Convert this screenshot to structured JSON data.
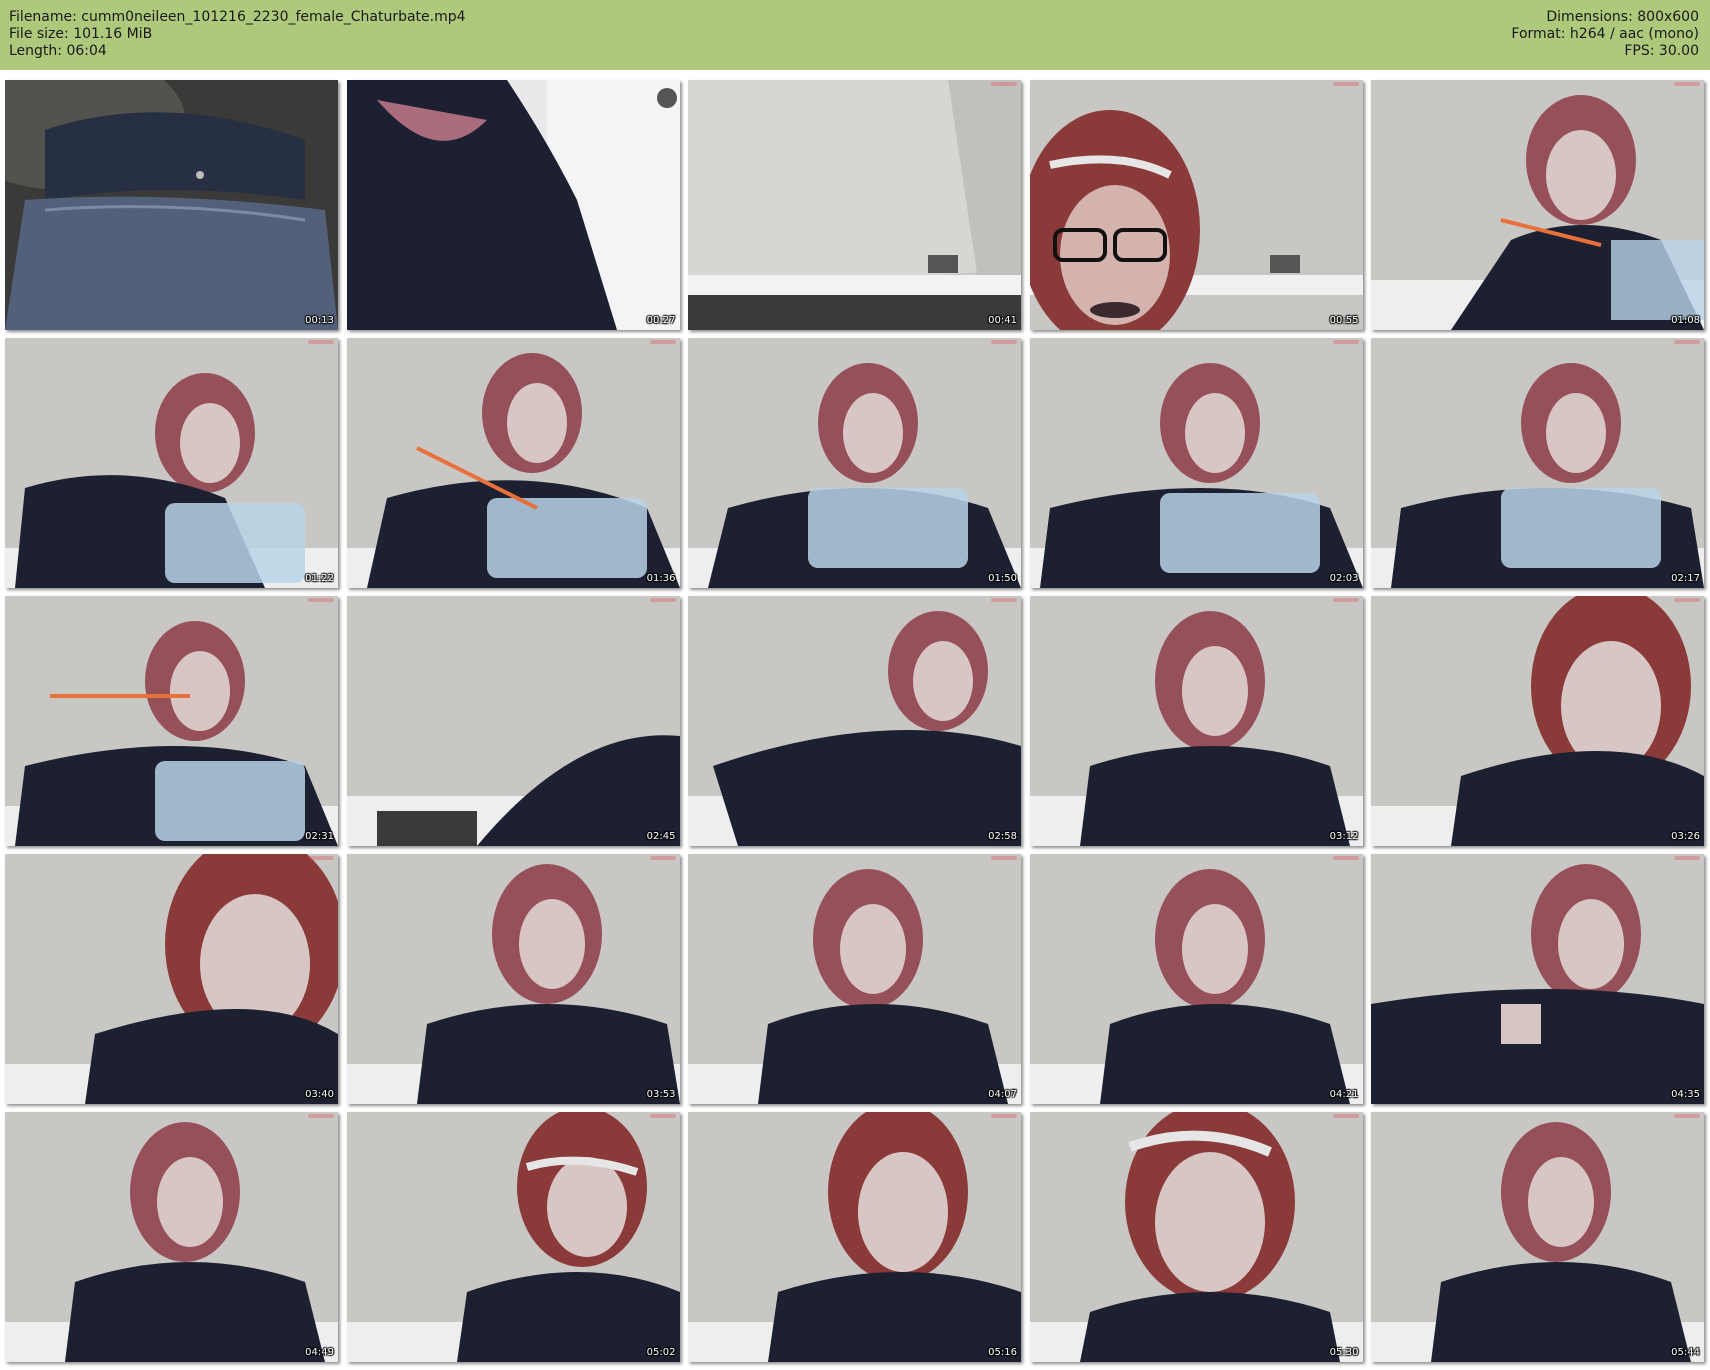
{
  "header": {
    "filename_line": "Filename: cumm0neileen_101216_2230_female_Chaturbate.mp4",
    "filesize_line": "File size: 101.16 MiB",
    "length_line": "Length: 06:04",
    "dimensions_line": "Dimensions: 800x600",
    "format_line": "Format: h264 / aac (mono)",
    "fps_line": "FPS: 30.00"
  },
  "colors": {
    "header_background": "#aec87c",
    "page_background": "#ffffff"
  },
  "thumbnails": [
    {
      "time": "00:13"
    },
    {
      "time": "00:27"
    },
    {
      "time": "00:41"
    },
    {
      "time": "00:55"
    },
    {
      "time": "01:08"
    },
    {
      "time": "01:22"
    },
    {
      "time": "01:36"
    },
    {
      "time": "01:50"
    },
    {
      "time": "02:03"
    },
    {
      "time": "02:17"
    },
    {
      "time": "02:31"
    },
    {
      "time": "02:45"
    },
    {
      "time": "02:58"
    },
    {
      "time": "03:12"
    },
    {
      "time": "03:26"
    },
    {
      "time": "03:40"
    },
    {
      "time": "03:53"
    },
    {
      "time": "04:07"
    },
    {
      "time": "04:21"
    },
    {
      "time": "04:35"
    },
    {
      "time": "04:49"
    },
    {
      "time": "05:02"
    },
    {
      "time": "05:16"
    },
    {
      "time": "05:30"
    },
    {
      "time": "05:44"
    }
  ]
}
